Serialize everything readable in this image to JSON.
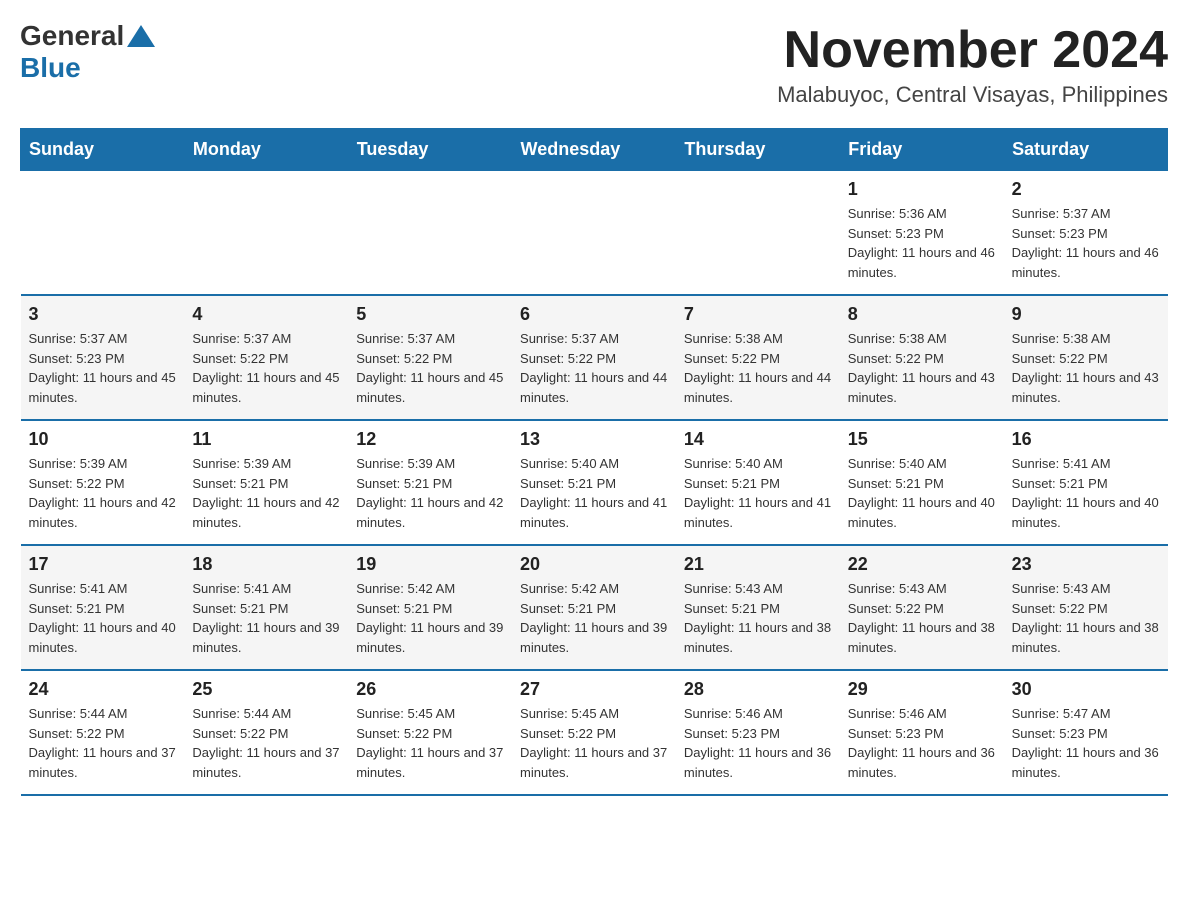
{
  "header": {
    "logo_general": "General",
    "logo_blue": "Blue",
    "month_title": "November 2024",
    "location": "Malabuyoc, Central Visayas, Philippines"
  },
  "weekdays": [
    "Sunday",
    "Monday",
    "Tuesday",
    "Wednesday",
    "Thursday",
    "Friday",
    "Saturday"
  ],
  "weeks": [
    [
      {
        "day": "",
        "info": ""
      },
      {
        "day": "",
        "info": ""
      },
      {
        "day": "",
        "info": ""
      },
      {
        "day": "",
        "info": ""
      },
      {
        "day": "",
        "info": ""
      },
      {
        "day": "1",
        "info": "Sunrise: 5:36 AM\nSunset: 5:23 PM\nDaylight: 11 hours and 46 minutes."
      },
      {
        "day": "2",
        "info": "Sunrise: 5:37 AM\nSunset: 5:23 PM\nDaylight: 11 hours and 46 minutes."
      }
    ],
    [
      {
        "day": "3",
        "info": "Sunrise: 5:37 AM\nSunset: 5:23 PM\nDaylight: 11 hours and 45 minutes."
      },
      {
        "day": "4",
        "info": "Sunrise: 5:37 AM\nSunset: 5:22 PM\nDaylight: 11 hours and 45 minutes."
      },
      {
        "day": "5",
        "info": "Sunrise: 5:37 AM\nSunset: 5:22 PM\nDaylight: 11 hours and 45 minutes."
      },
      {
        "day": "6",
        "info": "Sunrise: 5:37 AM\nSunset: 5:22 PM\nDaylight: 11 hours and 44 minutes."
      },
      {
        "day": "7",
        "info": "Sunrise: 5:38 AM\nSunset: 5:22 PM\nDaylight: 11 hours and 44 minutes."
      },
      {
        "day": "8",
        "info": "Sunrise: 5:38 AM\nSunset: 5:22 PM\nDaylight: 11 hours and 43 minutes."
      },
      {
        "day": "9",
        "info": "Sunrise: 5:38 AM\nSunset: 5:22 PM\nDaylight: 11 hours and 43 minutes."
      }
    ],
    [
      {
        "day": "10",
        "info": "Sunrise: 5:39 AM\nSunset: 5:22 PM\nDaylight: 11 hours and 42 minutes."
      },
      {
        "day": "11",
        "info": "Sunrise: 5:39 AM\nSunset: 5:21 PM\nDaylight: 11 hours and 42 minutes."
      },
      {
        "day": "12",
        "info": "Sunrise: 5:39 AM\nSunset: 5:21 PM\nDaylight: 11 hours and 42 minutes."
      },
      {
        "day": "13",
        "info": "Sunrise: 5:40 AM\nSunset: 5:21 PM\nDaylight: 11 hours and 41 minutes."
      },
      {
        "day": "14",
        "info": "Sunrise: 5:40 AM\nSunset: 5:21 PM\nDaylight: 11 hours and 41 minutes."
      },
      {
        "day": "15",
        "info": "Sunrise: 5:40 AM\nSunset: 5:21 PM\nDaylight: 11 hours and 40 minutes."
      },
      {
        "day": "16",
        "info": "Sunrise: 5:41 AM\nSunset: 5:21 PM\nDaylight: 11 hours and 40 minutes."
      }
    ],
    [
      {
        "day": "17",
        "info": "Sunrise: 5:41 AM\nSunset: 5:21 PM\nDaylight: 11 hours and 40 minutes."
      },
      {
        "day": "18",
        "info": "Sunrise: 5:41 AM\nSunset: 5:21 PM\nDaylight: 11 hours and 39 minutes."
      },
      {
        "day": "19",
        "info": "Sunrise: 5:42 AM\nSunset: 5:21 PM\nDaylight: 11 hours and 39 minutes."
      },
      {
        "day": "20",
        "info": "Sunrise: 5:42 AM\nSunset: 5:21 PM\nDaylight: 11 hours and 39 minutes."
      },
      {
        "day": "21",
        "info": "Sunrise: 5:43 AM\nSunset: 5:21 PM\nDaylight: 11 hours and 38 minutes."
      },
      {
        "day": "22",
        "info": "Sunrise: 5:43 AM\nSunset: 5:22 PM\nDaylight: 11 hours and 38 minutes."
      },
      {
        "day": "23",
        "info": "Sunrise: 5:43 AM\nSunset: 5:22 PM\nDaylight: 11 hours and 38 minutes."
      }
    ],
    [
      {
        "day": "24",
        "info": "Sunrise: 5:44 AM\nSunset: 5:22 PM\nDaylight: 11 hours and 37 minutes."
      },
      {
        "day": "25",
        "info": "Sunrise: 5:44 AM\nSunset: 5:22 PM\nDaylight: 11 hours and 37 minutes."
      },
      {
        "day": "26",
        "info": "Sunrise: 5:45 AM\nSunset: 5:22 PM\nDaylight: 11 hours and 37 minutes."
      },
      {
        "day": "27",
        "info": "Sunrise: 5:45 AM\nSunset: 5:22 PM\nDaylight: 11 hours and 37 minutes."
      },
      {
        "day": "28",
        "info": "Sunrise: 5:46 AM\nSunset: 5:23 PM\nDaylight: 11 hours and 36 minutes."
      },
      {
        "day": "29",
        "info": "Sunrise: 5:46 AM\nSunset: 5:23 PM\nDaylight: 11 hours and 36 minutes."
      },
      {
        "day": "30",
        "info": "Sunrise: 5:47 AM\nSunset: 5:23 PM\nDaylight: 11 hours and 36 minutes."
      }
    ]
  ]
}
